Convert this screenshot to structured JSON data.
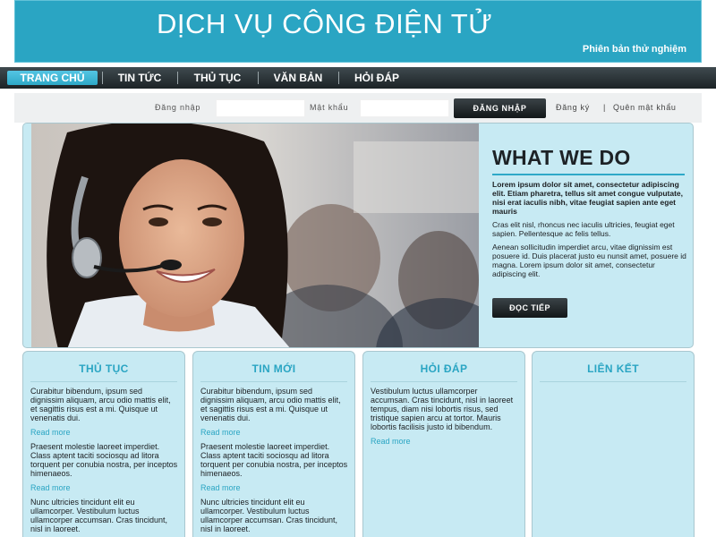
{
  "header": {
    "title": "DỊCH VỤ CÔNG ĐIỆN TỬ",
    "subtitle": "Phiên bản thử nghiệm"
  },
  "nav": {
    "items": [
      {
        "label": "TRANG CHỦ",
        "active": true
      },
      {
        "label": "TIN TỨC",
        "active": false
      },
      {
        "label": "THỦ TỤC",
        "active": false
      },
      {
        "label": "VĂN BẢN",
        "active": false
      },
      {
        "label": "HỎI ĐÁP",
        "active": false
      }
    ]
  },
  "login": {
    "username_label": "Đăng nhập",
    "username_value": "",
    "password_label": "Mật khẩu",
    "password_value": "",
    "submit_label": "ĐĂNG NHẬP",
    "register_label": "Đăng ký",
    "separator": "|",
    "forgot_label": "Quên mật khẩu"
  },
  "feature": {
    "title": "WHAT WE DO",
    "lead": "Lorem ipsum dolor sit amet, consectetur adipiscing elit. Etiam pharetra, tellus sit amet congue vulputate, nisi erat iaculis nibh, vitae feugiat sapien ante eget mauris",
    "p1": "Cras elit nisl, rhoncus nec iaculis ultricies, feugiat eget sapien. Pellentesque ac felis tellus.",
    "p2": "Aenean sollicitudin imperdiet arcu, vitae dignissim est posuere id. Duis placerat justo eu nunsit amet, posuere id magna. Lorem ipsum dolor sit amet, consectetur adipiscing elit.",
    "button_label": "ĐỌC TIẾP",
    "accent_color": "#2aa5c3"
  },
  "columns": [
    {
      "title": "THỦ TỤC",
      "items": [
        {
          "text": "Curabitur bibendum, ipsum sed dignissim aliquam, arcu odio mattis elit, et sagittis risus est a mi. Quisque ut venenatis dui.",
          "link": "Read more"
        },
        {
          "text": "Praesent molestie laoreet imperdiet. Class aptent taciti sociosqu ad litora torquent per conubia nostra, per inceptos himenaeos.",
          "link": "Read more"
        },
        {
          "text": "Nunc ultricies tincidunt elit eu ullamcorper. Vestibulum luctus ullamcorper accumsan. Cras tincidunt, nisl in laoreet.",
          "link": ""
        }
      ]
    },
    {
      "title": "TIN MỚI",
      "items": [
        {
          "text": "Curabitur bibendum, ipsum sed dignissim aliquam, arcu odio mattis elit, et sagittis risus est a mi. Quisque ut venenatis dui.",
          "link": "Read more"
        },
        {
          "text": "Praesent molestie laoreet imperdiet. Class aptent taciti sociosqu ad litora torquent per conubia nostra, per inceptos himenaeos.",
          "link": "Read more"
        },
        {
          "text": "Nunc ultricies tincidunt elit eu ullamcorper. Vestibulum luctus ullamcorper accumsan. Cras tincidunt, nisl in laoreet.",
          "link": ""
        }
      ]
    },
    {
      "title": "HỎI ĐÁP",
      "items": [
        {
          "text": "Vestibulum luctus ullamcorper accumsan. Cras tincidunt, nisl in laoreet tempus, diam nisi lobortis risus, sed tristique sapien arcu at tortor. Mauris lobortis facilisis justo id bibendum.",
          "link": "Read more"
        }
      ]
    },
    {
      "title": "LIÊN KẾT",
      "items": []
    }
  ]
}
